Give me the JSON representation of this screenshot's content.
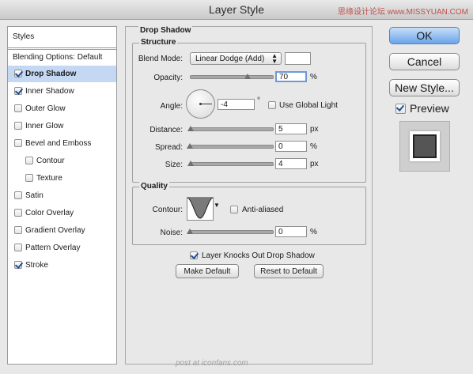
{
  "window": {
    "title": "Layer Style",
    "watermark": "思缘设计论坛 www.MISSYUAN.COM"
  },
  "left_panel": {
    "header": "Styles",
    "blending": "Blending Options: Default",
    "items": [
      {
        "label": "Drop Shadow",
        "checked": true,
        "selected": true
      },
      {
        "label": "Inner Shadow",
        "checked": true
      },
      {
        "label": "Outer Glow",
        "checked": false
      },
      {
        "label": "Inner Glow",
        "checked": false
      },
      {
        "label": "Bevel and Emboss",
        "checked": false
      },
      {
        "label": "Contour",
        "checked": false
      },
      {
        "label": "Texture",
        "checked": false
      },
      {
        "label": "Satin",
        "checked": false
      },
      {
        "label": "Color Overlay",
        "checked": false
      },
      {
        "label": "Gradient Overlay",
        "checked": false
      },
      {
        "label": "Pattern Overlay",
        "checked": false
      },
      {
        "label": "Stroke",
        "checked": true
      }
    ]
  },
  "panel": {
    "title": "Drop Shadow",
    "structure": {
      "title": "Structure",
      "blend_mode_label": "Blend Mode:",
      "blend_mode_value": "Linear Dodge (Add)",
      "opacity_label": "Opacity:",
      "opacity_value": "70",
      "opacity_unit": "%",
      "opacity_level": 0.7,
      "angle_label": "Angle:",
      "angle_value": "-4",
      "angle_unit": "°",
      "global_light_label": "Use Global Light",
      "distance_label": "Distance:",
      "distance_value": "5",
      "distance_unit": "px",
      "spread_label": "Spread:",
      "spread_value": "0",
      "spread_unit": "%",
      "size_label": "Size:",
      "size_value": "4",
      "size_unit": "px"
    },
    "quality": {
      "title": "Quality",
      "contour_label": "Contour:",
      "anti_aliased_label": "Anti-aliased",
      "noise_label": "Noise:",
      "noise_value": "0",
      "noise_unit": "%"
    },
    "knockout_label": "Layer Knocks Out Drop Shadow",
    "make_default": "Make Default",
    "reset_default": "Reset to Default"
  },
  "actions": {
    "ok": "OK",
    "cancel": "Cancel",
    "new_style": "New Style...",
    "preview": "Preview"
  },
  "footer_watermark": "post at iconfans.com"
}
